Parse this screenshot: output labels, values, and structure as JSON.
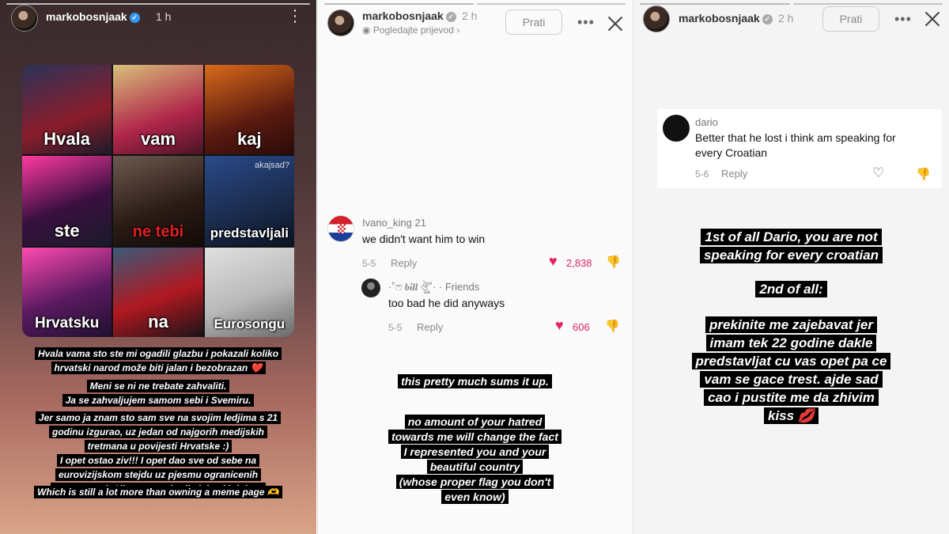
{
  "panel1": {
    "username": "markobosnjaak",
    "time_ago": "1 h",
    "meme_cells": [
      "Hvala",
      "vam",
      "kaj",
      "ste",
      "ne tebi",
      "predstavljali",
      "Hrvatsku",
      "na",
      "Eurosongu"
    ],
    "watermark": "akajsad?",
    "caption1": [
      "Hvala vama sto ste mi ogadili glazbu i pokazali koliko",
      "hrvatski narod može biti jalan i bezobrazan ❤️"
    ],
    "caption2": [
      "Meni se ni ne trebate zahvaliti.",
      "Ja se zahvaljujem samom sebi i Svemiru."
    ],
    "caption3": [
      "Jer samo ja znam sto sam sve na svojim ledjima s 21",
      "godinu izgurao, uz jedan od najgorih medijskih",
      "tretmana u povijesti Hrvatske :)",
      "I opet ostao ziv!!! I opet dao sve od sebe na",
      "eurovizijskom stejdu uz pjesmu ogranicenih",
      "mogucnosti. Ali sam to odradio jebacki dobro."
    ],
    "caption4": "Which is still a lot more than owning a meme page 🫶"
  },
  "panel2": {
    "username": "markobosnjaak",
    "time_ago": "2 h",
    "translation_link": "Pogledajte prijevod",
    "follow_label": "Prati",
    "comment1": {
      "user": "Ivano_king 21",
      "text": "we didn't want him to win",
      "date": "5-5",
      "reply": "Reply",
      "likes": "2,838"
    },
    "comment2": {
      "user": "·˚ෆ 𝒃𝒊𝒍𝒍 ঔৣ˚· · Friends",
      "text": "too bad he did anyways",
      "date": "5-5",
      "reply": "Reply",
      "likes": "606"
    },
    "caption1": "this pretty much sums it up.",
    "caption2": [
      "no amount of your hatred",
      "towards me will change the fact",
      "I represented you and your",
      "beautiful country",
      "(whose proper flag you don't",
      "even know)"
    ]
  },
  "panel3": {
    "username": "markobosnjaak",
    "time_ago": "2 h",
    "follow_label": "Prati",
    "comment": {
      "user": "dario",
      "text": [
        "Better that he lost i think am speaking for",
        "every Croatian"
      ],
      "date": "5-6",
      "reply": "Reply"
    },
    "caption1": [
      "1st of all Dario, you are not",
      "speaking for every croatian"
    ],
    "caption2": "2nd of all:",
    "caption3": [
      "prekinite me zajebavat jer",
      "imam tek 22 godine dakle",
      "predstavljat cu vas opet pa ce",
      "vam se gace trest. ajde sad",
      "cao i pustite me da zhivim",
      "kiss 💋"
    ]
  }
}
